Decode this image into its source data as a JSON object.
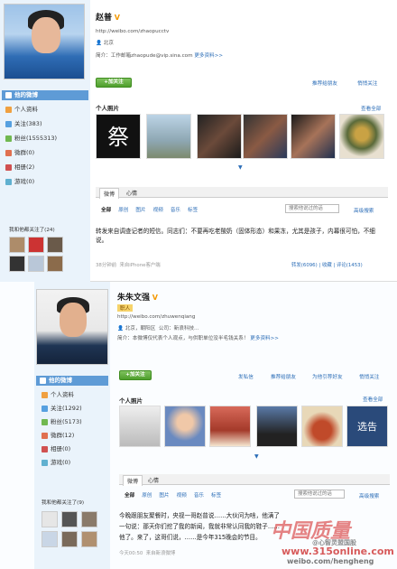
{
  "profile1": {
    "name": "赵普",
    "url": "http://weibo.com/zhaopucctv",
    "location": "北京",
    "intro_label": "简介：",
    "intro": "工作邮箱zhaopude@vip.sina.com",
    "more": "更多资料>>",
    "follow_btn": "+加关注",
    "actions": [
      "推荐给朋友",
      "悄悄关注"
    ],
    "sidebar": [
      {
        "label": "他的微博",
        "icon": "home-icon"
      },
      {
        "label": "个人资料",
        "icon": "profile-icon"
      },
      {
        "label": "关注(383)",
        "icon": "follow-icon"
      },
      {
        "label": "粉丝(1555313)",
        "icon": "fans-icon"
      },
      {
        "label": "微群(0)",
        "icon": "group-icon"
      },
      {
        "label": "相册(2)",
        "icon": "album-icon"
      },
      {
        "label": "游戏(0)",
        "icon": "game-icon"
      }
    ],
    "follows_title": "我和他都关注了(24)",
    "photos_title": "个人照片",
    "view_all": "查看全部",
    "photo_char": "祭",
    "tabs": [
      "微博",
      "心情"
    ],
    "filters": [
      "全部",
      "原创",
      "图片",
      "视频",
      "音乐",
      "标签"
    ],
    "search_placeholder": "搜索他说过的话",
    "adv_search": "高级搜索",
    "post": "转发来自调查记者的短信。同志们：不要再吃老酸奶（固体形态）和果冻，尤其是孩子，内幕很可怕，不细说。",
    "post_time": "38分钟前",
    "post_source": "来自iPhone客户端",
    "post_stats": "转发(6096)  |  收藏  |  评论(1453)"
  },
  "profile2": {
    "name": "朱朱文强",
    "badge": "职人",
    "url": "http://weibo.com/zhuwenqiang",
    "location": "北京，朝阳区",
    "company": "公司：新浪科技...",
    "intro_label": "简介：",
    "intro": "本微博仅代表个人观点，与供职单位没半毛钱关系！",
    "more": "更多资料>>",
    "follow_btn": "+加关注",
    "actions": [
      "发私信",
      "推荐给朋友",
      "为他引荐好友",
      "悄悄关注"
    ],
    "sidebar": [
      {
        "label": "他的微博",
        "icon": "home-icon"
      },
      {
        "label": "个人资料",
        "icon": "profile-icon"
      },
      {
        "label": "关注(1292)",
        "icon": "follow-icon"
      },
      {
        "label": "粉丝(5173)",
        "icon": "fans-icon"
      },
      {
        "label": "微群(12)",
        "icon": "group-icon"
      },
      {
        "label": "相册(0)",
        "icon": "album-icon"
      },
      {
        "label": "游戏(0)",
        "icon": "game-icon"
      }
    ],
    "follows_title": "我和他都关注了(9)",
    "photos_title": "个人照片",
    "view_all": "查看全部",
    "photo_sign": "选告",
    "tabs": [
      "微博",
      "心情"
    ],
    "filters": [
      "全部",
      "原创",
      "图片",
      "视频",
      "音乐",
      "标签"
    ],
    "search_placeholder": "搜索他说过的话",
    "adv_search": "高级搜索",
    "post_line1": "今晚跟朋友聚餐时，央视一哥赵普说……大伙问为啥，他满了",
    "post_line2": "一句说：那天你们挖了我的新闻，我就非常认同我的鞋子……",
    "post_line3": "他了。来了，这哥们说，……是今年315晚会的节目。",
    "post_time": "今天00:50",
    "post_source": "来自新浪微博"
  },
  "watermark": {
    "brand": "中国质量",
    "site": "www.315online.com",
    "weibo": "weibo.com/hengheng",
    "note": "@心智灵盟国股"
  },
  "colors": {
    "accent": "#2b6db7",
    "sidebar_bg": "#eaf3fb",
    "active": "#5e9bd6",
    "follow_green": "#4e9e2c",
    "vip": "#f39800"
  }
}
